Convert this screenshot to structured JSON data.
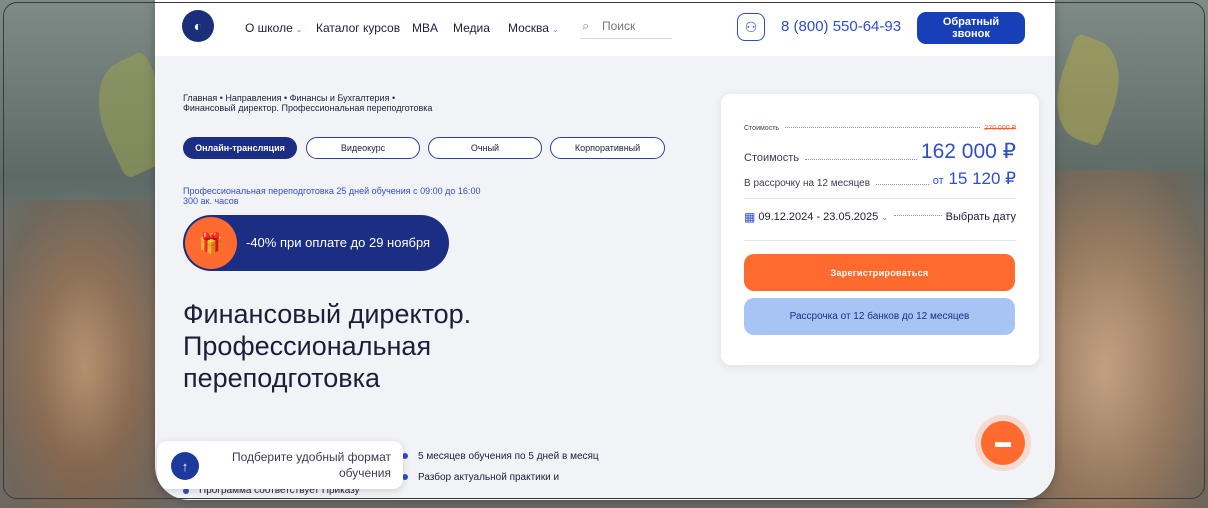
{
  "nav": {
    "about": "О школе",
    "catalog": "Каталог курсов",
    "mba": "MBA",
    "media": "Медиа",
    "city": "Москва",
    "search_placeholder": "Поиск",
    "phone": "8 (800) 550-64-93",
    "callback": "Обратный звонок"
  },
  "breadcrumbs": {
    "line1": "Главная  •  Направления  •  Финансы и Бухгалтерия  •",
    "line2": "Финансовый директор. Профессиональная переподготовка"
  },
  "formats": {
    "online": "Онлайн-трансляция",
    "video": "Видеокурс",
    "offline": "Очный",
    "corporate": "Корпоративный"
  },
  "meta": {
    "line1": "Профессиональная переподготовка   25 дней обучения с 09:00 до 16:00",
    "line2": "300 ак. часов"
  },
  "promo": {
    "text": "-40% при оплате до 29 ноября"
  },
  "title": "Финансовый директор. Профессиональная переподготовка",
  "bullets": {
    "b1": "5 месяцев обучения по 5 дней в месяц",
    "b2": "Разбор актуальной практики и",
    "b3": "Программа соответствует Приказу"
  },
  "pick_format": {
    "text": "Подберите удобный формат обучения"
  },
  "price_card": {
    "old_label": "Стоимость",
    "old_price": "270 000 ₽",
    "price_label": "Стоимость",
    "price": "162 000 ₽",
    "installment_label": "В рассрочку на 12 месяцев",
    "installment_prefix": "от",
    "installment_value": "15 120 ₽",
    "date_range": "09.12.2024 - 23.05.2025",
    "choose_date": "Выбрать дату",
    "register": "Зарегистрироваться",
    "installment_btn": "Рассрочка от 12 банков до 12 месяцев"
  },
  "colors": {
    "accent": "#2f4dcc",
    "navy": "#1c2e84",
    "orange": "#ff6a2e",
    "light_blue": "#a8c4f4"
  }
}
